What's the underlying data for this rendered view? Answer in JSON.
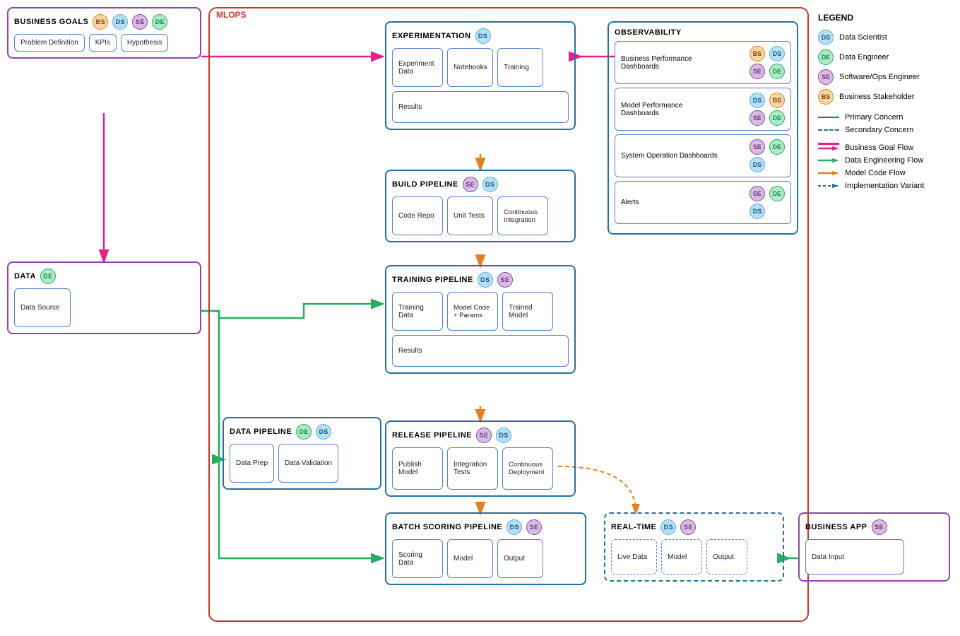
{
  "legend": {
    "title": "LEGEND",
    "items": [
      {
        "badge": "DS",
        "type": "ds",
        "label": "Data Scientist"
      },
      {
        "badge": "DE",
        "type": "de",
        "label": "Data Engineer"
      },
      {
        "badge": "SE",
        "type": "se",
        "label": "Software/Ops Engineer"
      },
      {
        "badge": "BS",
        "type": "bs",
        "label": "Business Stakeholder"
      }
    ],
    "lines": [
      {
        "style": "primary",
        "label": "Primary Concern"
      },
      {
        "style": "secondary",
        "label": "Secondary Concern"
      }
    ],
    "flows": [
      {
        "color": "magenta",
        "label": "Business Goal Flow"
      },
      {
        "color": "green",
        "label": "Data Engineering Flow"
      },
      {
        "color": "orange",
        "label": "Model Code Flow"
      },
      {
        "color": "blue-dashed",
        "label": "Implementation Variant"
      }
    ]
  },
  "mlops_label": "MLOPS",
  "business_goals": {
    "title": "BUSINESS GOALS",
    "badges": [
      "BS",
      "DS",
      "SE",
      "DE"
    ],
    "items": [
      "Problem Definition",
      "KPIs",
      "Hypothesis"
    ]
  },
  "data_section": {
    "title": "DATA",
    "badges": [
      "DE"
    ],
    "items": [
      "Data Source"
    ]
  },
  "data_pipeline": {
    "title": "DATA PIPELINE",
    "badges": [
      "DE",
      "DS"
    ],
    "items": [
      "Data Prep",
      "Data Validation"
    ]
  },
  "experimentation": {
    "title": "EXPERIMENTATION",
    "badges": [
      "DS"
    ],
    "row1": [
      "Experiment Data",
      "Notebooks",
      "Training"
    ],
    "row2": [
      "Results"
    ]
  },
  "build_pipeline": {
    "title": "BUILD PIPELINE",
    "badges": [
      "SE",
      "DS"
    ],
    "items": [
      "Code Repo",
      "Unit Tests",
      "Continuous Integration"
    ]
  },
  "training_pipeline": {
    "title": "TRAINING PIPELINE",
    "badges": [
      "DS",
      "SE"
    ],
    "row1": [
      "Training Data",
      "Model Code + Params",
      "Trained Model"
    ],
    "row2": [
      "Results"
    ]
  },
  "release_pipeline": {
    "title": "RELEASE PIPELINE",
    "badges": [
      "SE",
      "DS"
    ],
    "items": [
      "Publish Model",
      "Integration Tests",
      "Continuous Deployment"
    ]
  },
  "batch_scoring": {
    "title": "BATCH SCORING PIPELINE",
    "badges": [
      "DS",
      "SE"
    ],
    "items": [
      "Scoring Data",
      "Model",
      "Output"
    ]
  },
  "observability": {
    "title": "OBSERVABILITY",
    "panels": [
      {
        "label": "Business Performance Dashboards",
        "badges": [
          [
            "BS",
            "DS"
          ],
          [
            "SE",
            "DE"
          ]
        ]
      },
      {
        "label": "Model Performance Dashboards",
        "badges": [
          [
            "DS",
            "BS"
          ],
          [
            "SE",
            "DE"
          ]
        ]
      },
      {
        "label": "System Operation Dashboards",
        "badges": [
          [
            "SE",
            "DE"
          ],
          [
            "DS"
          ]
        ]
      },
      {
        "label": "Alerts",
        "badges": [
          [
            "SE",
            "DE"
          ],
          [
            "DS"
          ]
        ]
      }
    ]
  },
  "real_time": {
    "title": "REAL-TIME",
    "badges": [
      "DS",
      "SE"
    ],
    "items": [
      "Live Data",
      "Model",
      "Output"
    ]
  },
  "business_app": {
    "title": "BUSINESS APP",
    "badges": [
      "SE"
    ],
    "items": [
      "Data Input"
    ]
  }
}
